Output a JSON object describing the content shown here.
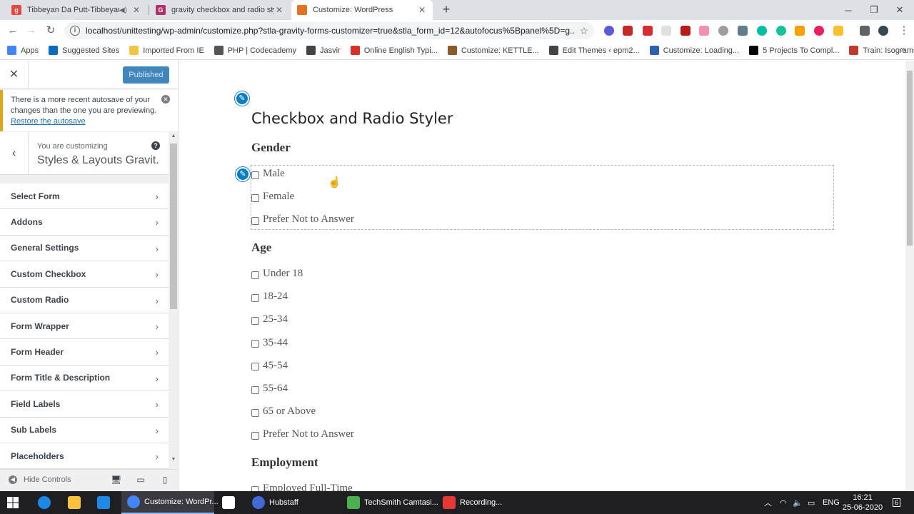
{
  "browser": {
    "tabs": [
      {
        "label": "Tibbeyan Da Putt-Tibbeyan D",
        "favicon_color": "#e8453c",
        "favicon_letter": "g",
        "active": false
      },
      {
        "label": "gravity checkbox and radio styler",
        "favicon_color": "#b0306a",
        "favicon_letter": "G",
        "active": false
      },
      {
        "label": "Customize: WordPress",
        "favicon_color": "#e37222",
        "favicon_letter": "",
        "active": true
      }
    ],
    "new_tab_glyph": "+",
    "url": "localhost/unittesting/wp-admin/customize.php?stla-gravity-forms-customizer=true&stla_form_id=12&autofocus%5Bpanel%5D=g...",
    "bookmarks": [
      {
        "label": "Apps",
        "color": "#4285f4"
      },
      {
        "label": "Suggested Sites",
        "color": "#0b6cbf"
      },
      {
        "label": "Imported From IE",
        "color": "#f4c542"
      },
      {
        "label": "PHP | Codecademy",
        "color": "#555555"
      },
      {
        "label": "Jasvir",
        "color": "#444444"
      },
      {
        "label": "Online English Typi...",
        "color": "#d93025"
      },
      {
        "label": "Customize: KETTLE...",
        "color": "#8a5a2b"
      },
      {
        "label": "Edit Themes ‹ epm2...",
        "color": "#444444"
      },
      {
        "label": "Customize: Loading...",
        "color": "#2b5fb3"
      },
      {
        "label": "5 Projects To Compl...",
        "color": "#000000"
      },
      {
        "label": "Train: Isograms | Co...",
        "color": "#c0392b"
      }
    ]
  },
  "sidebar": {
    "close_glyph": "✕",
    "publish_label": "Published",
    "notice_text": "There is a more recent autosave of your changes than the one you are previewing.",
    "notice_link": "Restore the autosave",
    "crumb_small": "You are customizing",
    "crumb_title": "Styles & Layouts Gravit...",
    "items": [
      {
        "label": "Select Form"
      },
      {
        "label": "Addons"
      },
      {
        "label": "General Settings"
      },
      {
        "label": "Custom Checkbox"
      },
      {
        "label": "Custom Radio"
      },
      {
        "label": "Form Wrapper"
      },
      {
        "label": "Form Header"
      },
      {
        "label": "Form Title & Description"
      },
      {
        "label": "Field Labels"
      },
      {
        "label": "Sub Labels"
      },
      {
        "label": "Placeholders"
      }
    ],
    "hide_controls": "Hide Controls"
  },
  "preview": {
    "form_title": "Checkbox and Radio Styler",
    "fields": [
      {
        "legend": "Gender",
        "choices": [
          "Male",
          "Female",
          "Prefer Not to Answer"
        ]
      },
      {
        "legend": "Age",
        "choices": [
          "Under 18",
          "18-24",
          "25-34",
          "35-44",
          "45-54",
          "55-64",
          "65 or Above",
          "Prefer Not to Answer"
        ]
      },
      {
        "legend": "Employment",
        "choices": [
          "Employed Full-Time"
        ]
      }
    ]
  },
  "taskbar": {
    "apps": [
      {
        "label": "Customize: WordPr...",
        "color": "#4285f4",
        "active": true
      },
      {
        "label": "Hubstaff",
        "color": "#3f6ad8",
        "active": false
      },
      {
        "label": "TechSmith Camtasi...",
        "color": "#4caf50",
        "active": false
      },
      {
        "label": "Recording...",
        "color": "#e53935",
        "active": false
      }
    ],
    "lang": "ENG",
    "time": "16:21",
    "date": "25-06-2020",
    "notification_count": "6"
  }
}
